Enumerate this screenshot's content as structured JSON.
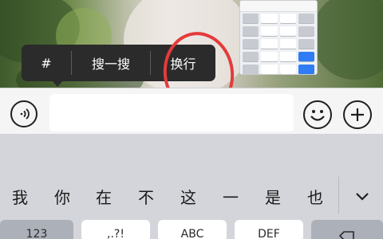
{
  "popup_menu": {
    "items": [
      {
        "label": "#"
      },
      {
        "label": "搜一搜"
      },
      {
        "label": "换行"
      }
    ]
  },
  "candidates": [
    "我",
    "你",
    "在",
    "不",
    "这",
    "一",
    "是",
    "也"
  ],
  "bottom_keys": [
    {
      "label": "123"
    },
    {
      "label": ",.?!"
    },
    {
      "label": "ABC"
    },
    {
      "label": "DEF"
    },
    {
      "label": ""
    },
    {
      "label": ""
    }
  ],
  "colors": {
    "annotation_ring": "#e33b3b",
    "popup_bg": "#2b2b2b",
    "keyboard_bg": "#d3d5da"
  }
}
